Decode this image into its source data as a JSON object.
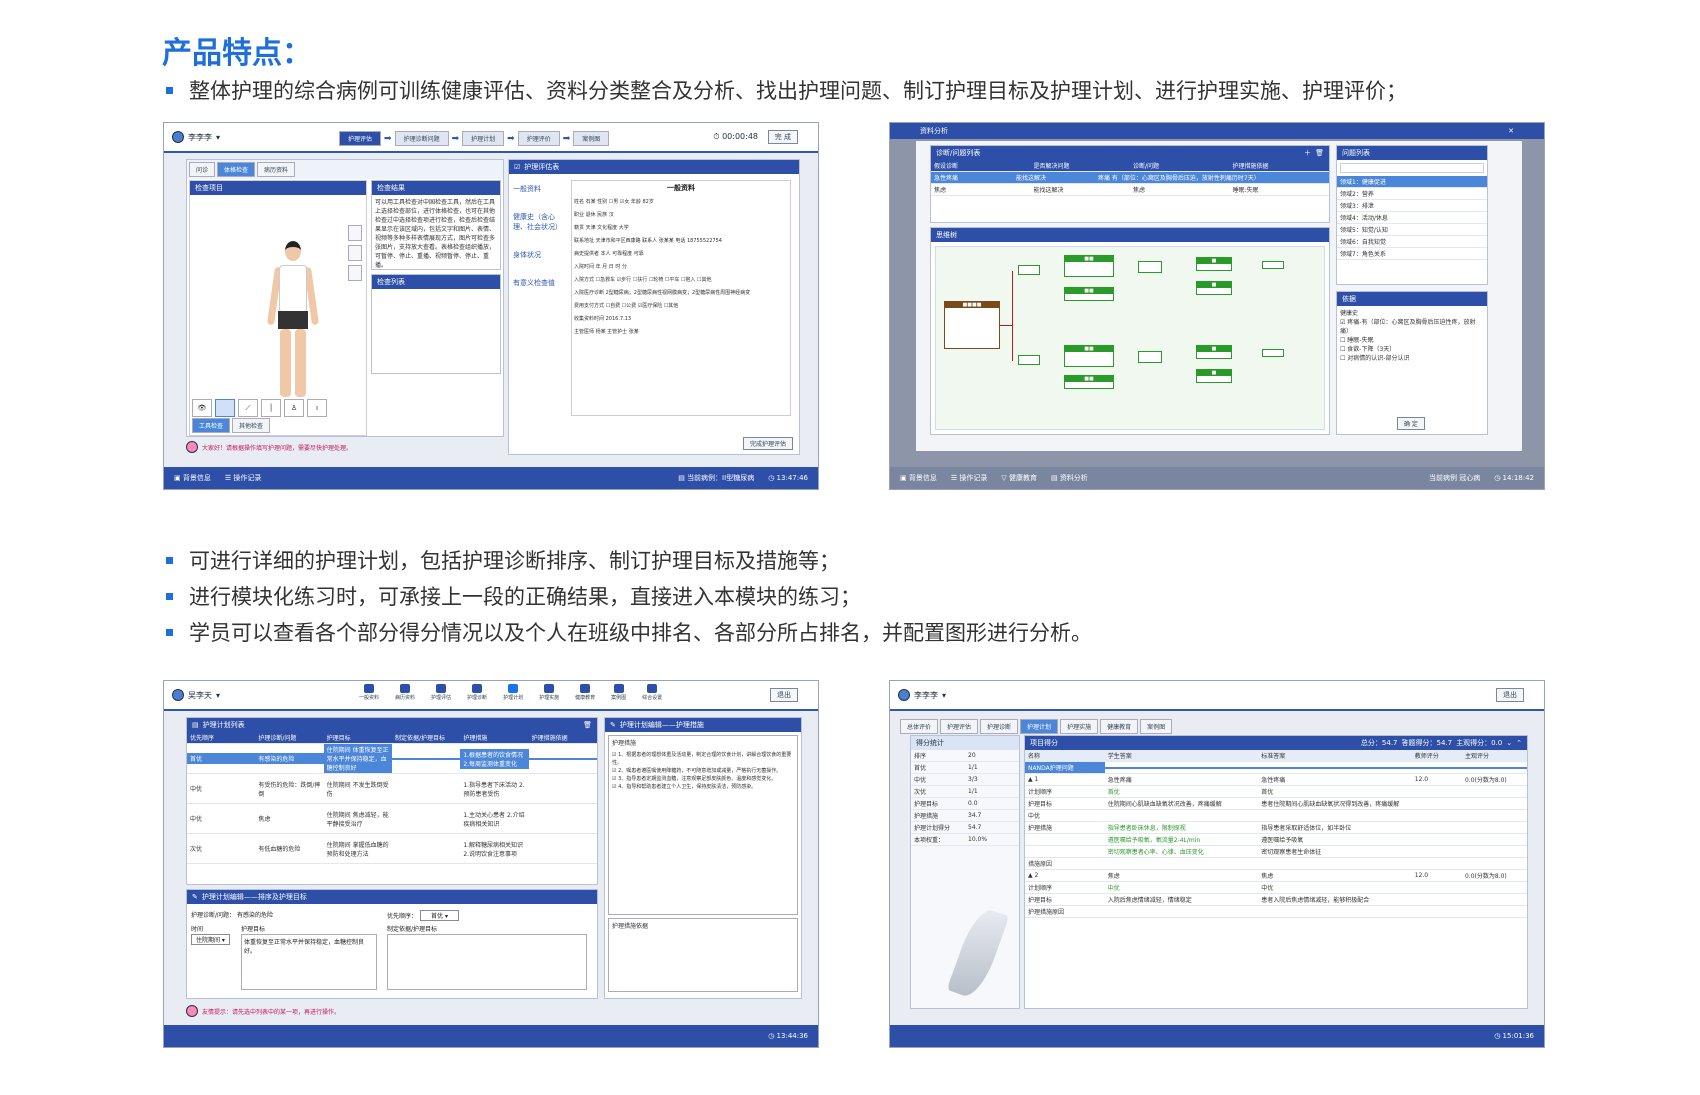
{
  "heading": "产品特点：",
  "bullets_top": [
    "整体护理的综合病例可训练健康评估、资料分类整合及分析、找出护理问题、制订护理目标及护理计划、进行护理实施、护理评价；"
  ],
  "bullets_mid": [
    "可进行详细的护理计划，包括护理诊断排序、制订护理目标及措施等；",
    "进行模块化练习时，可承接上一段的正确结果，直接进入本模块的练习；",
    "学员可以查看各个部分得分情况以及个人在班级中排名、各部分所占排名，并配置图形进行分析。"
  ],
  "accent": "#1e6fd9",
  "shot1": {
    "user": "李李李",
    "steps": [
      "护理评估",
      "护理诊断问题",
      "护理计划",
      "护理评价",
      "案例图"
    ],
    "timer": "00:00:48",
    "finish": "完 成",
    "tabs": [
      "问诊",
      "体格检查",
      "病历资料"
    ],
    "panel_check": "检查项目",
    "panel_result": "检查结果",
    "result_text": "可以用工具检查对中国检查工具，然后在工具上选择检查部位，进行体格检查，也可在其他检查过中选择检查项进行检查，检查后检查结果显示在该区域内，包括文字和图片、表情、视频等多种多样表情展现方式，图片可检查多张图片，支持放大查看。表格检查组织播放，可暂停、停止、重播、视频暂停、停止、重播。",
    "panel_list": "检查列表",
    "assess_title": "护理评估表",
    "assess_nav": [
      "一般资料",
      "健康史（含心理、社会状况）",
      "身体状况",
      "有意义检查值"
    ],
    "form_title": "一般资料",
    "form_lines": [
      "姓名  石某    性别  ☐男 ☑女   年龄  82岁",
      "职业  退休    民族  汉",
      "籍贯  天津    文化程度  大学",
      "联系地址  天津市和平区西康路   联系人  张某某   电话  18755522754",
      "病史提供者  本人    可靠程度  可靠",
      "入院时间       年      月      日      时      分",
      "入院方式  ☐急救车 ☑步行 ☐扶行 ☐轮椅 ☐平车 ☐抱入 ☐其他",
      "入院医疗诊断  2型糖尿病；2型糖尿病性视网膜病变；2型糖尿病性周围神经病变",
      "费用支付方式  ☐自费 ☐公费 ☑医疗保险 ☐其他",
      "收集资料时间  2016.7.13",
      "主管医师  杨某           主管护士  张某"
    ],
    "finish_assess": "完成护理评估",
    "tool_tabs": [
      "工具检查",
      "其他检查"
    ],
    "tip": "大家好！请根据操作填写护理问题，需要尽快护理处理。",
    "bottom": [
      "背景信息",
      "操作记录",
      "当前病例：II型糖尿病",
      "13:47:46"
    ]
  },
  "shot2": {
    "title": "资料分析",
    "diag_title": "诊断/问题列表",
    "diag_cols": [
      "假设诊断",
      "是否解决问题",
      "诊断/问题",
      "护理措施依据"
    ],
    "diag_rows": [
      [
        "急性疼痛",
        "能找这解决",
        "疼痛 有（部位：心窝区及胸骨后压迫，放射性刺痛历时7天）",
        ""
      ],
      [
        "焦虑",
        "能找这解决",
        "焦虑",
        "睡眠:失眠"
      ]
    ],
    "mind_title": "思维树",
    "problem_title": "问题列表",
    "problems": [
      "领域1：健康促进",
      "领域2：营养",
      "领域3：排泄",
      "领域4：活动/休息",
      "领域5：知觉/认知",
      "领域6：自我知觉",
      "领域7：角色关系"
    ],
    "basis_title": "依据",
    "basis": [
      "健康史",
      "☑ 疼痛-有（部位：心窝区及胸骨后压迫性疼，放射痛）",
      "☐ 睡眠-失眠",
      "☐ 食欲-下降（3天）",
      "☐ 对病情的认识-部分认识"
    ],
    "confirm": "确 定",
    "bottom": [
      "背景信息",
      "操作记录",
      "健康教育",
      "资料分析",
      "当前病例 冠心病",
      "14:18:42"
    ]
  },
  "shot3": {
    "user": "吴李天",
    "nav": [
      "一般资料",
      "病历资料",
      "护理评估",
      "护理诊断",
      "护理计划",
      "护理实施",
      "健康教育",
      "案例图",
      "综合设置"
    ],
    "exit": "退出",
    "plan_title": "护理计划列表",
    "plan_cols": [
      "优先顺序",
      "护理诊断/问题",
      "护理目标",
      "制定依据/护理目标",
      "护理措施",
      "护理措施依据"
    ],
    "plan_rows": [
      [
        "首优",
        "有感染的危险",
        "住院期间 体重恢复至正常水平并保持稳定，血糖控制良好",
        "",
        "1.根据患者的饮食情况 2.每周监测体重变化",
        ""
      ],
      [
        "中优",
        "有受伤的危险：跌倒/摔倒",
        "住院期间 不发生跌倒受伤",
        "",
        "1.指导患者下床活动 2.预防患者受伤",
        ""
      ],
      [
        "中优",
        "焦虑",
        "住院期间 焦虑减轻，能平静接受治疗",
        "",
        "1.主动关心患者 2.介绍疾病相关知识",
        ""
      ],
      [
        "次优",
        "有低血糖的危险",
        "住院期间 掌握低血糖的预防和处理方法",
        "",
        "1.解释糖尿病相关知识 2.说明饮食注意事项",
        ""
      ]
    ],
    "measure_title": "护理计划编辑——护理措施",
    "measure_label": "护理措施",
    "measures": [
      "☑ 1、根据患者的理想体重及活动量，制定合理的饮食计划，讲解合理饮食的重要性。",
      "☑ 2、嘱患者遵医嘱使用降糖药，不可随意增加或减量，严格执行无菌操作。",
      "☑ 3、指导患者定期监测血糖，注意观察足部皮肤颜色、温度和感觉变化。",
      "☑ 4、指导和帮助患者建立个人卫生，保持皮肤清洁，预防感染。"
    ],
    "measure_basis": "护理措施依据",
    "goal_title": "护理计划编辑——排序及护理目标",
    "diag_label": "护理诊断/问题：",
    "diag_value": "有感染的危险",
    "priority_label": "优先顺序：",
    "priority_value": "首优",
    "period_label": "时间",
    "period_value": "住院期间",
    "goal_label": "护理目标",
    "goal_value": "体重恢复至正常水平并保持稳定，血糖控制良好。",
    "basis_label": "制定依据/护理目标",
    "tip": "友情提示：请先选中列表中的某一项，再进行操作。",
    "time": "13:44:36"
  },
  "shot4": {
    "user": "李李李",
    "exit": "退出",
    "tabs": [
      "总体评价",
      "护理评估",
      "护理诊断",
      "护理计划",
      "护理实施",
      "健康教育",
      "案例图"
    ],
    "stats_title": "得分统计",
    "stats": [
      [
        "排序",
        "20"
      ],
      [
        "首优",
        "1/1"
      ],
      [
        "中优",
        "3/3"
      ],
      [
        "次优",
        "1/1"
      ],
      [
        "护理目标",
        "0.0"
      ],
      [
        "护理措施",
        "34.7"
      ],
      [
        "护理计划得分",
        "54.7"
      ],
      [
        "本项权重：",
        "10.0%"
      ]
    ],
    "score_title": "项目得分",
    "total": "总分：54.7",
    "got": "答题得分：54.7",
    "subj": "主观得分：0.0",
    "cols": [
      "名称",
      "学生答案",
      "标准答案",
      "教师评分",
      "主观评分"
    ],
    "rows": [
      [
        "NANDA护理问题",
        "",
        "",
        "",
        ""
      ],
      [
        "▲ 1",
        "急性疼痛",
        "急性疼痛",
        "12.0",
        "0.0(分数为8.0)"
      ],
      [
        "计划顺序",
        "首优",
        "首优",
        "",
        ""
      ],
      [
        "护理目标",
        "住院期间心肌缺血缺氧状况改善，疼痛缓解",
        "患者住院期间心肌缺血缺氧状况得到改善，疼痛缓解",
        "",
        ""
      ],
      [
        "中优",
        "",
        "",
        "",
        ""
      ],
      [
        "护理措施",
        "指导患者卧床休息，限制探视",
        "指导患者采取舒适体位，如半卧位",
        "",
        ""
      ],
      [
        "",
        "遵医嘱给予吸氧，氧流量2-4L/min",
        "遵医嘱给予吸氧",
        "",
        ""
      ],
      [
        "",
        "密切观察患者心率、心律、血压变化",
        "密切观察患者生命体征",
        "",
        ""
      ],
      [
        "措施原因",
        "",
        "",
        "",
        ""
      ],
      [
        "▲ 2",
        "焦虑",
        "焦虑",
        "12.0",
        "0.0(分数为8.0)"
      ],
      [
        "计划顺序",
        "中优",
        "中优",
        "",
        ""
      ],
      [
        "护理目标",
        "入院后焦虑情绪减轻，情绪稳定",
        "患者入院后焦虑情绪减轻，能够积极配合",
        "",
        ""
      ],
      [
        "护理措施原因",
        "",
        "",
        "",
        ""
      ]
    ],
    "time": "15:01:36"
  }
}
